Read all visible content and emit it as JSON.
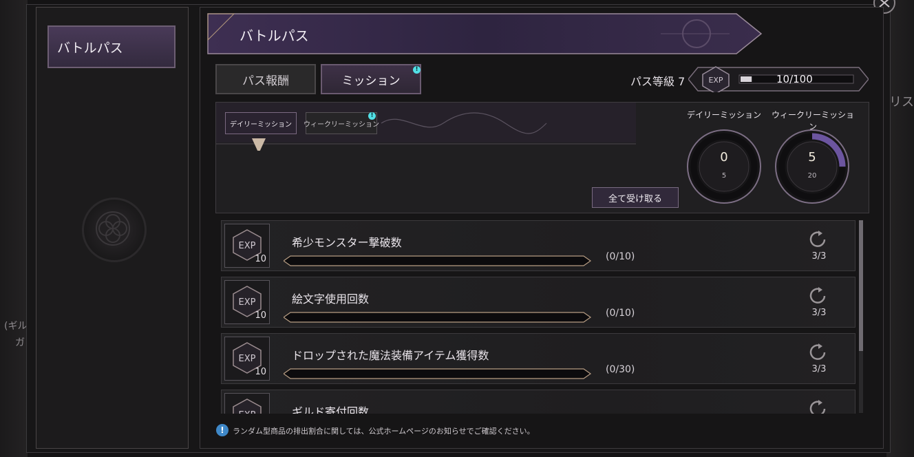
{
  "background": {
    "right_text": "リス",
    "left_text_1": "(ギル",
    "left_text_2": "ガ"
  },
  "sidebar": {
    "items": [
      {
        "label": "バトルパス"
      }
    ]
  },
  "header": {
    "title": "バトルパス"
  },
  "tabs": [
    {
      "label": "パス報酬"
    },
    {
      "label": "ミッション",
      "badge": "!"
    }
  ],
  "pass": {
    "level_label": "パス等級 7",
    "exp_icon_text": "EXP",
    "exp_value": "10/100",
    "exp_progress": 0.1
  },
  "sub_tabs": [
    {
      "label": "デイリーミッション"
    },
    {
      "label": "ウィークリーミッション",
      "badge": "!"
    }
  ],
  "claim_all": {
    "label": "全て受け取る"
  },
  "progress_rings": [
    {
      "label": "デイリーミッション",
      "value": "0",
      "max": "5",
      "progress": 0.0
    },
    {
      "label": "ウィークリーミッション",
      "value": "5",
      "max": "20",
      "progress": 0.25
    }
  ],
  "missions": [
    {
      "exp_icon": "EXP",
      "reward": "10",
      "title": "希少モンスター撃破数",
      "progress": "(0/10)",
      "repeat": "3/3"
    },
    {
      "exp_icon": "EXP",
      "reward": "10",
      "title": "絵文字使用回数",
      "progress": "(0/10)",
      "repeat": "3/3"
    },
    {
      "exp_icon": "EXP",
      "reward": "10",
      "title": "ドロップされた魔法装備アイテム獲得数",
      "progress": "(0/30)",
      "repeat": "3/3"
    },
    {
      "exp_icon": "EXP",
      "reward": "",
      "title": "ギルド寄付回数",
      "progress": "",
      "repeat": ""
    }
  ],
  "notice": {
    "icon": "!",
    "text": "ランダム型商品の排出割合に関しては、公式ホームページのお知らせでご確認ください。"
  },
  "colors": {
    "accent_purple": "#6a5a70",
    "badge_cyan": "#52e0e6",
    "info_blue": "#3f88c8"
  }
}
